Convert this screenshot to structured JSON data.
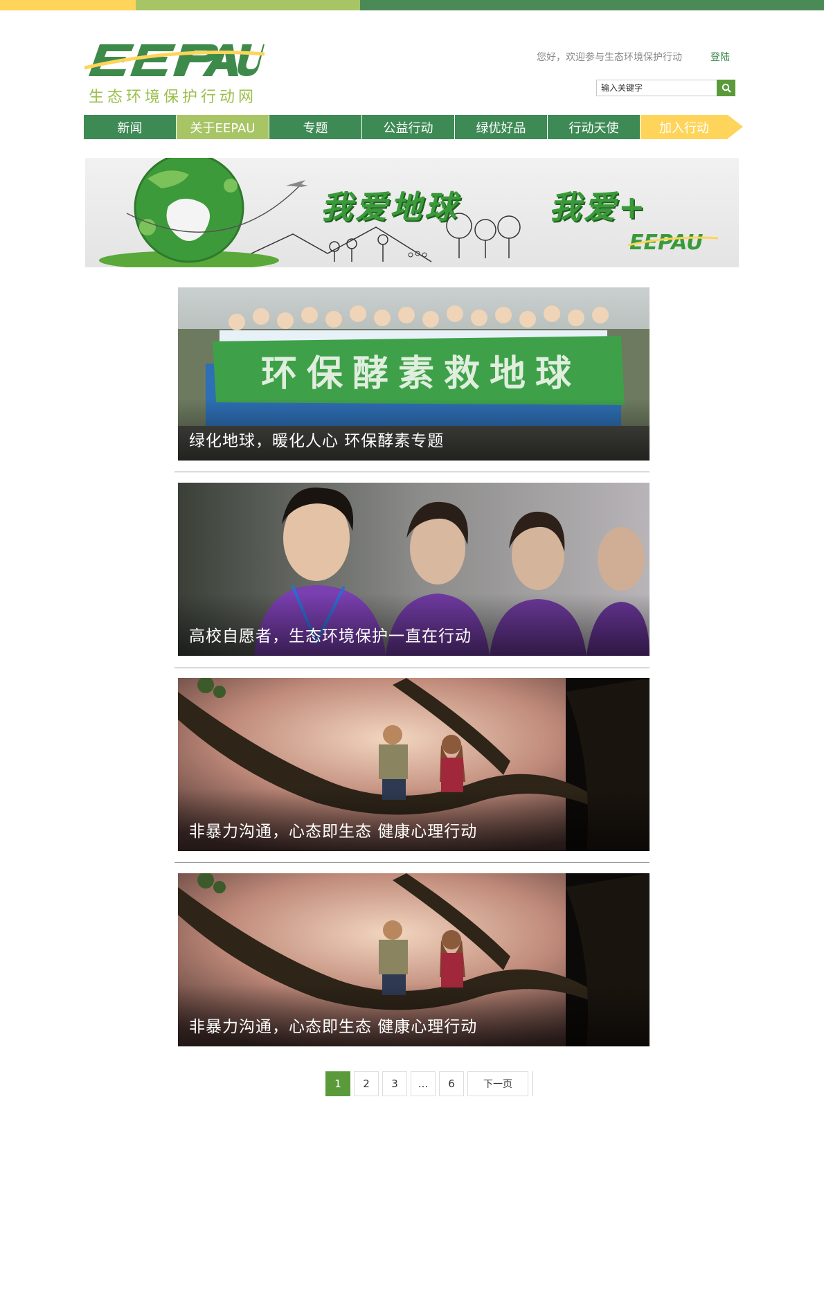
{
  "header": {
    "logo_text": "EEPAU",
    "logo_subtitle": "生态环境保护行动网",
    "welcome": "您好，欢迎参与生态环境保护行动",
    "login": "登陆",
    "search_placeholder": "输入关键字"
  },
  "nav": {
    "items": [
      {
        "label": "新闻"
      },
      {
        "label": "关于EEPAU"
      },
      {
        "label": "专题"
      },
      {
        "label": "公益行动"
      },
      {
        "label": "绿优好品"
      },
      {
        "label": "行动天使"
      },
      {
        "label": "加入行动"
      }
    ]
  },
  "banner": {
    "text1": "我爱地球",
    "text2": "我爱+",
    "logo": "EEPAU"
  },
  "cards": [
    {
      "caption": "绿化地球，暖化人心   环保酵素专题",
      "banner_text": "环保酵素救地球"
    },
    {
      "caption": "高校自愿者，生态环境保护一直在行动"
    },
    {
      "caption": "非暴力沟通，心态即生态  健康心理行动"
    },
    {
      "caption": "非暴力沟通，心态即生态  健康心理行动"
    }
  ],
  "pagination": {
    "pages": [
      "1",
      "2",
      "3",
      "...",
      "6"
    ],
    "current": "1",
    "next": "下一页"
  },
  "colors": {
    "yellow": "#fed45a",
    "light_green": "#a8c566",
    "green": "#3e8a55",
    "button_green": "#5a9a3a"
  }
}
